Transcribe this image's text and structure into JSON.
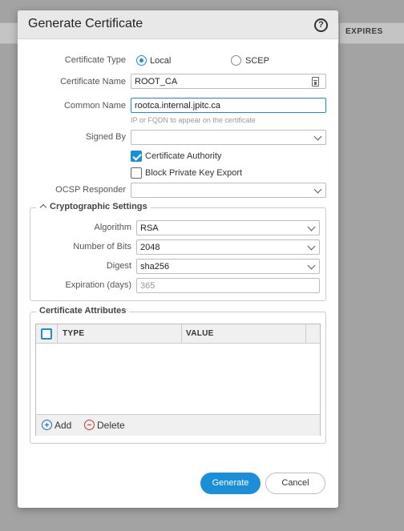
{
  "background": {
    "column_expires": "EXPIRES"
  },
  "dialog": {
    "title": "Generate Certificate",
    "help": "?",
    "certificate_type": {
      "label": "Certificate Type",
      "options": [
        "Local",
        "SCEP"
      ],
      "selected": "Local"
    },
    "certificate_name": {
      "label": "Certificate Name",
      "value": "ROOT_CA"
    },
    "common_name": {
      "label": "Common Name",
      "value": "rootca.internal.jpitc.ca",
      "hint": "IP or FQDN to appear on the certificate"
    },
    "signed_by": {
      "label": "Signed By",
      "value": ""
    },
    "certificate_authority": {
      "label": "Certificate Authority",
      "checked": true
    },
    "block_private_key_export": {
      "label": "Block Private Key Export",
      "checked": false
    },
    "ocsp_responder": {
      "label": "OCSP Responder",
      "value": ""
    },
    "crypto": {
      "legend": "Cryptographic Settings",
      "algorithm": {
        "label": "Algorithm",
        "value": "RSA"
      },
      "number_of_bits": {
        "label": "Number of Bits",
        "value": "2048"
      },
      "digest": {
        "label": "Digest",
        "value": "sha256"
      },
      "expiration": {
        "label": "Expiration (days)",
        "placeholder": "365"
      }
    },
    "attributes": {
      "legend": "Certificate Attributes",
      "columns": [
        "TYPE",
        "VALUE"
      ],
      "rows": [],
      "add_label": "Add",
      "delete_label": "Delete"
    },
    "buttons": {
      "generate": "Generate",
      "cancel": "Cancel"
    }
  },
  "colors": {
    "accent": "#1a8fd8",
    "delete": "#c0392b"
  }
}
